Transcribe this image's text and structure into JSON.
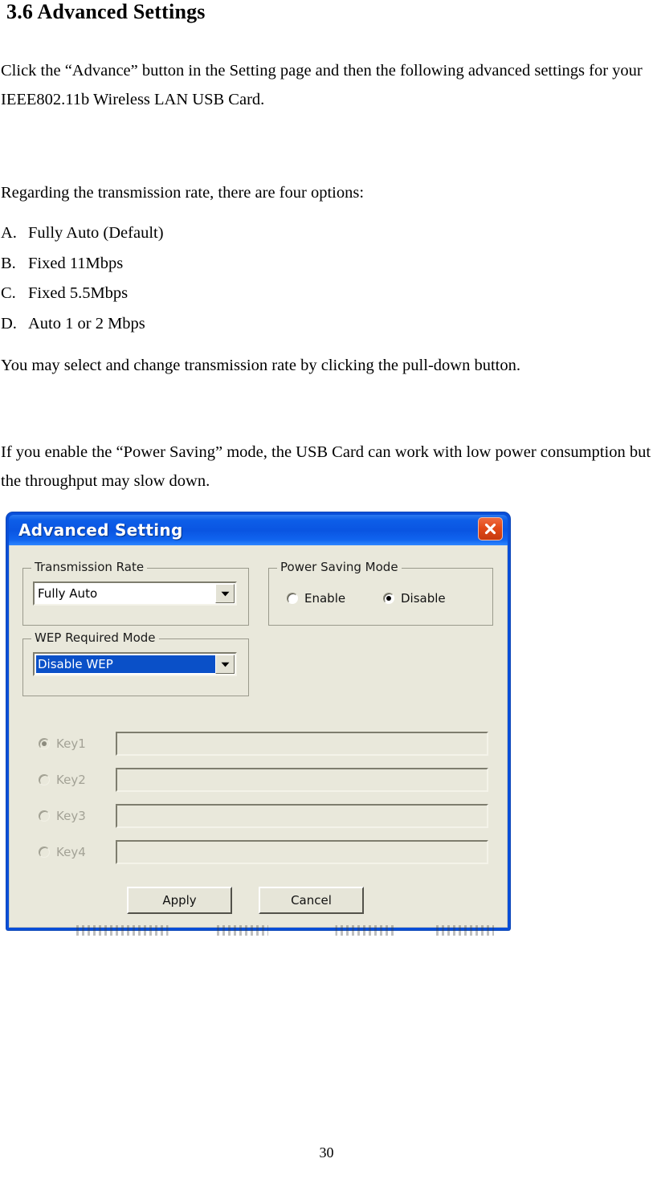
{
  "document": {
    "heading": "3.6 Advanced Settings",
    "intro_paragraph": "Click the “Advance” button in the Setting page and then the following advanced settings for your IEEE802.11b Wireless LAN USB Card.",
    "rate_intro": "Regarding the transmission rate, there are four options:",
    "rate_options": [
      {
        "marker": "A.",
        "text": "Fully Auto (Default)"
      },
      {
        "marker": "B.",
        "text": "Fixed 11Mbps"
      },
      {
        "marker": "C.",
        "text": "Fixed 5.5Mbps"
      },
      {
        "marker": "D.",
        "text": "Auto 1 or 2 Mbps"
      }
    ],
    "select_paragraph": "You may select and change transmission rate by clicking the pull-down button.",
    "power_paragraph": "If you enable the “Power Saving” mode, the USB Card can work with low power consumption but the throughput may slow down.",
    "page_number": "30"
  },
  "dialog": {
    "title": "Advanced Setting",
    "close_icon": "close-x-icon",
    "transmission_rate": {
      "group_title": "Transmission Rate",
      "selected_value": "Fully Auto",
      "arrow_icon": "chevron-down-icon"
    },
    "power_saving": {
      "group_title": "Power Saving Mode",
      "enable_label": "Enable",
      "disable_label": "Disable",
      "selected": "Disable"
    },
    "wep_required": {
      "group_title": "WEP Required Mode",
      "selected_value": "Disable WEP",
      "arrow_icon": "chevron-down-icon"
    },
    "keys": [
      {
        "label": "Key1",
        "value": "",
        "checked": true
      },
      {
        "label": "Key2",
        "value": "",
        "checked": false
      },
      {
        "label": "Key3",
        "value": "",
        "checked": false
      },
      {
        "label": "Key4",
        "value": "",
        "checked": false
      }
    ],
    "apply_label": "Apply",
    "cancel_label": "Cancel"
  },
  "colors": {
    "titlebar_blue": "#0a55e2",
    "dialog_body": "#e9e8db",
    "selection_blue": "#0a50c8",
    "close_red": "#e24a18",
    "disabled_text": "#a3a296"
  }
}
